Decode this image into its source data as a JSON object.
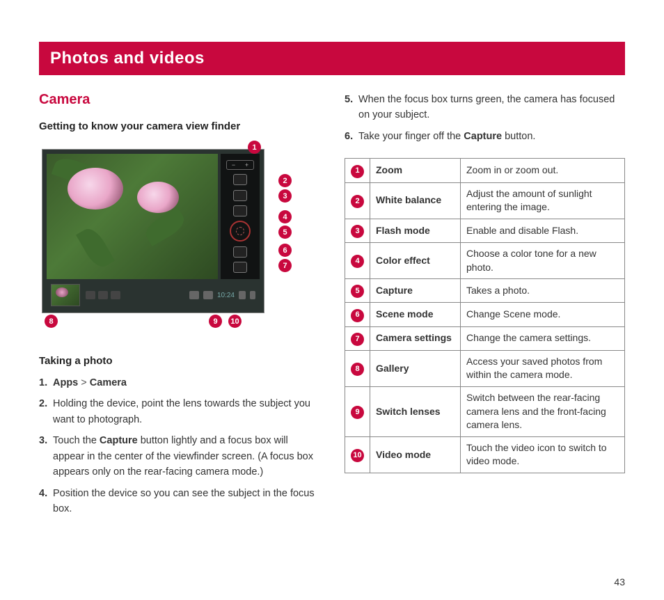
{
  "title": "Photos and videos",
  "section": "Camera",
  "sub_viewfinder": "Getting to know your camera view finder",
  "sub_photo": "Taking a photo",
  "steps_left": [
    {
      "num": "1.",
      "html": "<b>Apps</b> <span class='gt'>&gt;</span> <b>Camera</b>"
    },
    {
      "num": "2.",
      "html": "Holding the device, point the lens towards the subject you want to photograph."
    },
    {
      "num": "3.",
      "html": "Touch the <b>Capture</b> button lightly and a focus box will appear in the center of the viewfinder screen. (A focus box appears only on the rear-facing camera mode.)"
    },
    {
      "num": "4.",
      "html": "Position the device so you can see the subject in the focus box."
    }
  ],
  "steps_right": [
    {
      "num": "5.",
      "html": "When the focus box turns green, the camera has focused on your subject."
    },
    {
      "num": "6.",
      "html": "Take your finger off the <b>Capture</b> button."
    }
  ],
  "table": [
    {
      "n": "1",
      "name": "Zoom",
      "desc": "Zoom in or zoom out."
    },
    {
      "n": "2",
      "name": "White balance",
      "desc": "Adjust the amount of sunlight entering the image."
    },
    {
      "n": "3",
      "name": "Flash mode",
      "desc": "Enable and disable Flash."
    },
    {
      "n": "4",
      "name": "Color effect",
      "desc": "Choose a color tone for a new photo."
    },
    {
      "n": "5",
      "name": "Capture",
      "desc": "Takes a photo."
    },
    {
      "n": "6",
      "name": "Scene mode",
      "desc": "Change Scene mode."
    },
    {
      "n": "7",
      "name": "Camera settings",
      "desc": "Change the camera settings."
    },
    {
      "n": "8",
      "name": "Gallery",
      "desc": "Access your saved photos from within the camera mode."
    },
    {
      "n": "9",
      "name": "Switch lenses",
      "desc": "Switch between the rear-facing camera lens and the front-facing camera lens."
    },
    {
      "n": "10",
      "name": "Video mode",
      "desc": "Touch the video icon to switch to video mode."
    }
  ],
  "statusbar_time": "10:24",
  "markers": [
    "1",
    "2",
    "3",
    "4",
    "5",
    "6",
    "7",
    "8",
    "9",
    "10"
  ],
  "page_number": "43"
}
